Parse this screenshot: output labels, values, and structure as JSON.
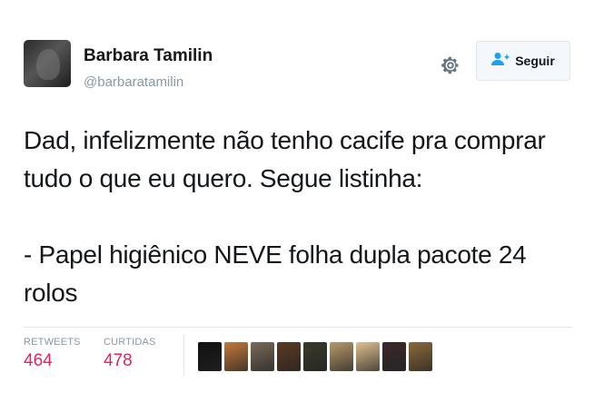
{
  "tweet": {
    "author": {
      "name": "Barbara Tamilin",
      "handle": "@barbaratamilin"
    },
    "follow_label": "Seguir",
    "text": "Dad, infelizmente não tenho cacife pra comprar\ntudo o que eu quero. Segue listinha:\n\n- Papel higiênico NEVE folha dupla pacote 24\nrolos",
    "stats": {
      "retweets_label": "RETWEETS",
      "retweets_value": "464",
      "likes_label": "CURTIDAS",
      "likes_value": "478"
    },
    "liker_avatar_colors": [
      "#111111",
      "#c47a3a",
      "#7a6a5a",
      "#5b3a22",
      "#3a3a2a",
      "#b89a6a",
      "#e0c090",
      "#3a2a2a",
      "#8a6a3a"
    ]
  },
  "colors": {
    "stat_value": "#e0245e",
    "muted": "#8899a6",
    "text": "#14171a"
  },
  "icons": [
    "gear-icon",
    "add-user-icon"
  ]
}
